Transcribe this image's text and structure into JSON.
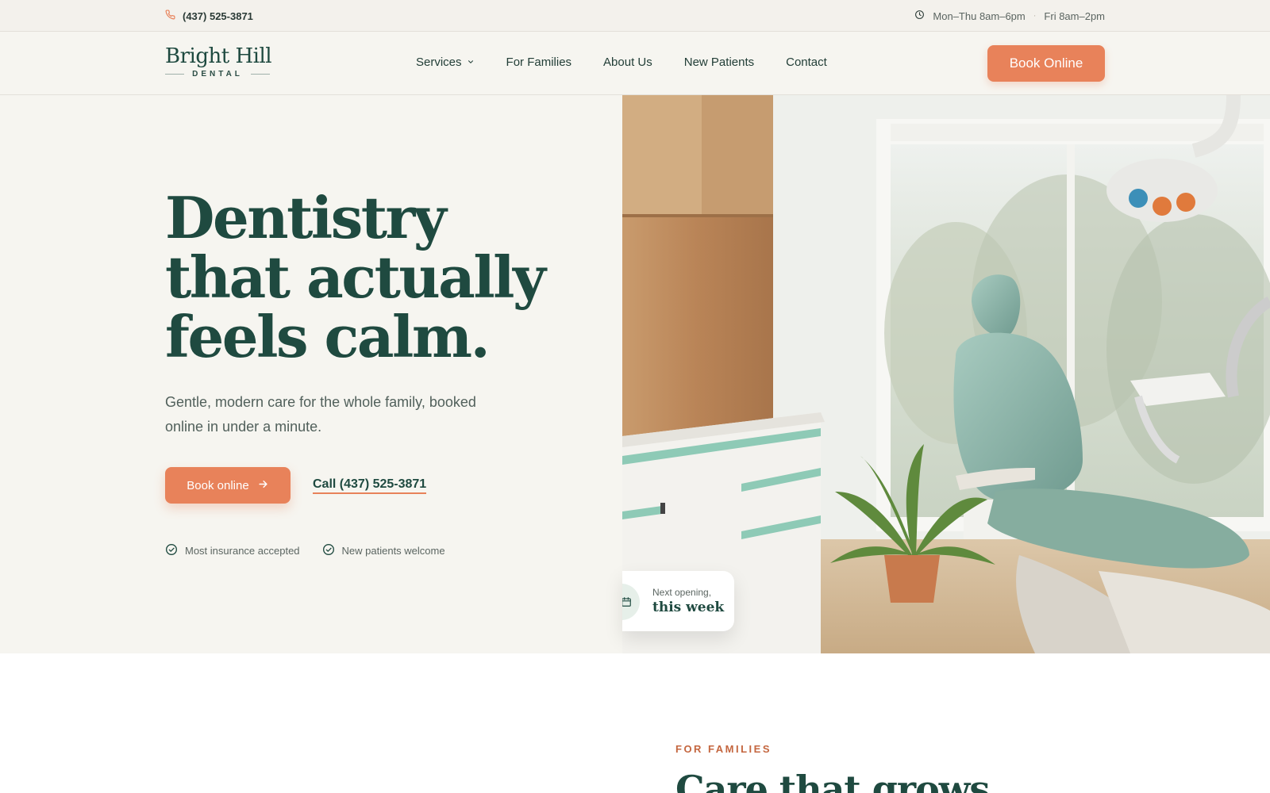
{
  "topbar": {
    "phone": "(437) 525-3871",
    "hours_weekday": "Mon–Thu 8am–6pm",
    "hours_separator": "·",
    "hours_friday": "Fri 8am–2pm"
  },
  "brand": {
    "name": "Bright Hill",
    "tagline": "DENTAL"
  },
  "nav": {
    "items": [
      {
        "label": "Services",
        "has_dropdown": true
      },
      {
        "label": "For Families"
      },
      {
        "label": "About Us"
      },
      {
        "label": "New Patients"
      },
      {
        "label": "Contact"
      }
    ],
    "cta": "Book Online"
  },
  "hero": {
    "title_lines": [
      "Dentistry",
      "that actually",
      "feels calm."
    ],
    "subtitle": "Gentle, modern care for the whole family, booked online in under a minute.",
    "primary_cta": "Book online",
    "secondary_cta": "Call (437) 525-3871",
    "badges": [
      "Most insurance accepted",
      "New patients welcome"
    ],
    "availability_card": {
      "label": "Next opening,",
      "value": "this week"
    }
  },
  "next_section": {
    "eyebrow": "FOR FAMILIES",
    "title": "Care that grows"
  },
  "colors": {
    "brand_green": "#1f4a40",
    "accent_orange": "#e8825a",
    "cream_bg": "#f6f5f0"
  },
  "icons": [
    "phone-icon",
    "clock-icon",
    "chevron-down-icon",
    "arrow-right-icon",
    "check-circle-icon",
    "calendar-icon"
  ]
}
